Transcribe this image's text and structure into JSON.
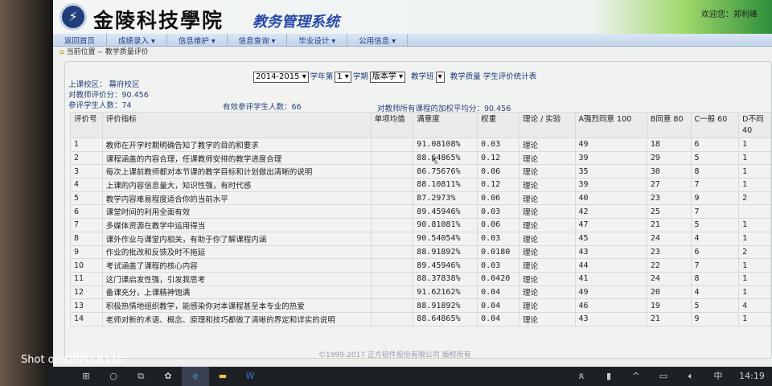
{
  "header": {
    "school": "金陵科技學院",
    "system": "教务管理系统",
    "welcome": "欢迎您：",
    "user": "郑利峰"
  },
  "nav": [
    "返回首页",
    "成绩录入 ▾",
    "信息维护 ▾",
    "信息查询 ▾",
    "毕业设计 ▾",
    "公用信息 ▾"
  ],
  "breadcrumb": "当前位置 -- 教学质量评价",
  "filters": {
    "year": "2014-2015",
    "year_suffix": "学年第",
    "term": "1",
    "term_suffix": "学期",
    "type": "版本学",
    "class_label": "教学班",
    "class_value": "",
    "title": "教学质量 学生评价统计表"
  },
  "info": {
    "campus": "上课校区： 幕府校区",
    "teacher_score": "对教师评价分：90.456",
    "participants": "参评学生人数：74",
    "valid": "有效参评学生人数：66",
    "weighted": "对教师所有课程的加权平均分：90.456"
  },
  "table": {
    "headers": [
      "评价号",
      "评价指标",
      "单项均值",
      "满意度",
      "权重",
      "理论 / 实验",
      "A强烈同意 100",
      "B同意 80",
      "C一般 60",
      "D不同 40"
    ],
    "rows": [
      [
        "1",
        "教师在开学时期明确告知了教学的目的和要求",
        "",
        "91.08108%",
        "0.03",
        "理论",
        "49",
        "18",
        "6",
        "1"
      ],
      [
        "2",
        "课程涵盖的内容合理，任课教师安排的教学进度合理",
        "",
        "88.64865%",
        "0.12",
        "理论",
        "39",
        "29",
        "5",
        "1"
      ],
      [
        "3",
        "每次上课前教师都对本节课的教学目标和计划做出清晰的说明",
        "",
        "86.75676%",
        "0.06",
        "理论",
        "35",
        "30",
        "8",
        "1"
      ],
      [
        "4",
        "上课的内容信息量大，知识性强，有时代感",
        "",
        "88.10811%",
        "0.12",
        "理论",
        "39",
        "27",
        "7",
        "1"
      ],
      [
        "5",
        "教学内容难易程度适合你的当前水平",
        "",
        "87.2973%",
        "0.06",
        "理论",
        "40",
        "23",
        "9",
        "2"
      ],
      [
        "6",
        "课堂时间的利用全面有效",
        "",
        "89.45946%",
        "0.03",
        "理论",
        "42",
        "25",
        "7",
        ""
      ],
      [
        "7",
        "多媒体资源在教学中运用得当",
        "",
        "90.81081%",
        "0.06",
        "理论",
        "47",
        "21",
        "5",
        "1"
      ],
      [
        "8",
        "课外作业与课堂内相关，有助于你了解课程内涵",
        "",
        "90.54054%",
        "0.03",
        "理论",
        "45",
        "24",
        "4",
        "1"
      ],
      [
        "9",
        "作业的批改和反馈及时不拖延",
        "",
        "88.91892%",
        "0.0180",
        "理论",
        "43",
        "23",
        "6",
        "2"
      ],
      [
        "10",
        "考试涵盖了课程的核心内容",
        "",
        "89.45946%",
        "0.03",
        "理论",
        "44",
        "22",
        "7",
        "1"
      ],
      [
        "11",
        "这门课启发性强，引发我思考",
        "",
        "88.37838%",
        "0.0420",
        "理论",
        "41",
        "24",
        "8",
        "1"
      ],
      [
        "12",
        "备课充分，上课精神饱满",
        "",
        "91.62162%",
        "0.04",
        "理论",
        "49",
        "20",
        "4",
        "1"
      ],
      [
        "13",
        "积极热情地组织教学，能感染你对本课程甚至本专业的热爱",
        "",
        "88.91892%",
        "0.04",
        "理论",
        "46",
        "19",
        "5",
        "4"
      ],
      [
        "14",
        "老师对新的术语、概念、原理和技巧都做了清晰的界定和详实的说明",
        "",
        "88.64865%",
        "0.04",
        "理论",
        "43",
        "21",
        "9",
        "1"
      ]
    ]
  },
  "footer": "©1999-2017 正方软件股份有限公司 版权所有",
  "taskbar": {
    "time": "14:19",
    "ime": "中"
  },
  "watermark": "Shot on OPPO R11s"
}
